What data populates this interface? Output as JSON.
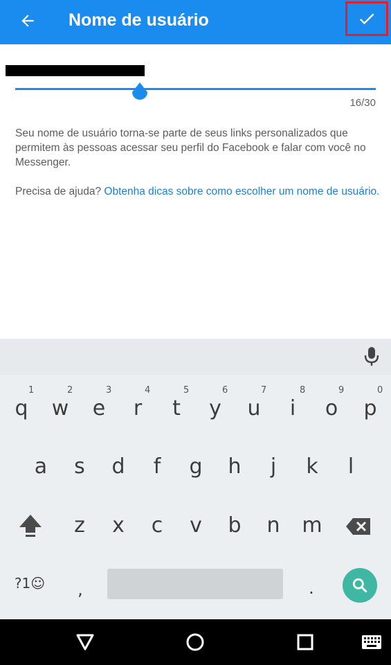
{
  "header": {
    "title": "Nome de usuário",
    "back_icon": "arrow-left-icon",
    "confirm_icon": "check-icon",
    "bg_color": "#1a8cf0",
    "highlight_color": "#e1202a"
  },
  "username_field": {
    "value": "",
    "counter": "16/30"
  },
  "help": {
    "description": "Seu nome de usuário torna-se parte de seus links personalizados que permitem às pessoas acessar seu perfil do Facebook e falar com você no Messenger.",
    "question": "Precisa de ajuda?",
    "link": "Obtenha dicas sobre como escolher um nome de usuário."
  },
  "keyboard": {
    "row1": [
      {
        "key": "q",
        "hint": "1"
      },
      {
        "key": "w",
        "hint": "2"
      },
      {
        "key": "e",
        "hint": "3"
      },
      {
        "key": "r",
        "hint": "4"
      },
      {
        "key": "t",
        "hint": "5"
      },
      {
        "key": "y",
        "hint": "6"
      },
      {
        "key": "u",
        "hint": "7"
      },
      {
        "key": "i",
        "hint": "8"
      },
      {
        "key": "o",
        "hint": "9"
      },
      {
        "key": "p",
        "hint": "0"
      }
    ],
    "row2": [
      "a",
      "s",
      "d",
      "f",
      "g",
      "h",
      "j",
      "k",
      "l"
    ],
    "row3": [
      "z",
      "x",
      "c",
      "v",
      "b",
      "n",
      "m"
    ],
    "symbols_label": "?1☺",
    "comma": ",",
    "period": ".",
    "accent_color": "#3fb7a3"
  }
}
